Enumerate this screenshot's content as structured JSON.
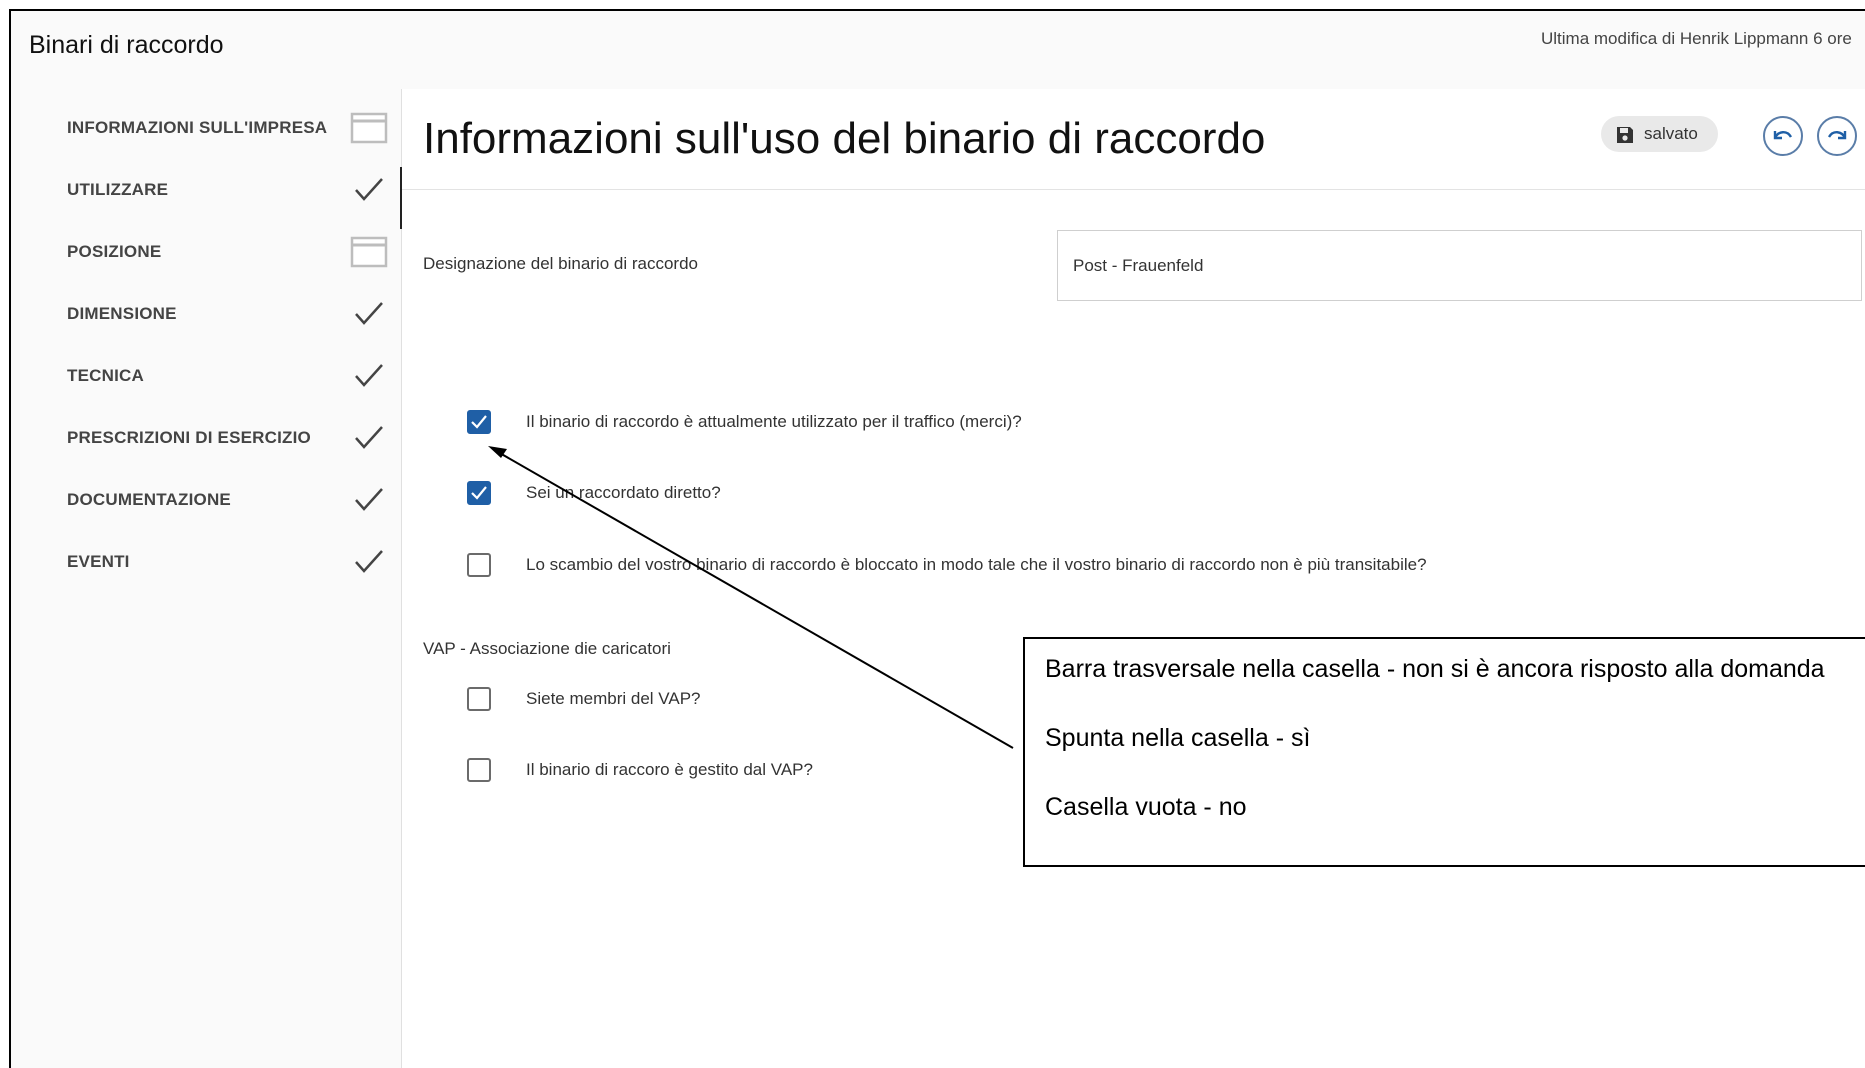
{
  "header": {
    "app_title": "Binari di raccordo",
    "last_modified": "Ultima modifica di Henrik Lippmann 6 ore"
  },
  "sidebar": {
    "items": [
      {
        "label": "INFORMAZIONI SULL'IMPRESA",
        "status": "barra-icon"
      },
      {
        "label": "UTILIZZARE",
        "status": "check-icon",
        "active": true
      },
      {
        "label": "POSIZIONE",
        "status": "barra-icon"
      },
      {
        "label": "DIMENSIONE",
        "status": "check-icon"
      },
      {
        "label": "TECNICA",
        "status": "check-icon"
      },
      {
        "label": "PRESCRIZIONI DI ESERCIZIO",
        "status": "check-icon"
      },
      {
        "label": "DOCUMENTAZIONE",
        "status": "check-icon"
      },
      {
        "label": "EVENTI",
        "status": "check-icon"
      }
    ]
  },
  "main": {
    "title": "Informazioni sull'uso del binario di raccordo",
    "saved_label": "salvato",
    "designation": {
      "label": "Designazione del binario di raccordo",
      "value": "Post - Frauenfeld"
    },
    "questions": [
      {
        "label": "Il binario di raccordo è attualmente utilizzato per il traffico (merci)?",
        "checked": true
      },
      {
        "label": "Sei un raccordato diretto?",
        "checked": true
      },
      {
        "label": "Lo scambio del vostro binario di raccordo è bloccato in modo tale che il vostro binario di raccordo non è più transitabile?",
        "checked": false
      }
    ],
    "vap_section": {
      "label": "VAP - Associazione die caricatori",
      "questions": [
        {
          "label": "Siete membri del VAP?",
          "checked": false
        },
        {
          "label": "Il binario di raccoro è gestito dal VAP?",
          "checked": false
        }
      ]
    }
  },
  "annotation": {
    "lines": [
      "Barra trasversale nella casella - non si è ancora risposto alla domanda",
      "Spunta nella casella - sì",
      "Casella vuota - no"
    ]
  },
  "colors": {
    "checkbox_checked": "#1f5fa6",
    "round_button_border": "#5a7da8"
  }
}
